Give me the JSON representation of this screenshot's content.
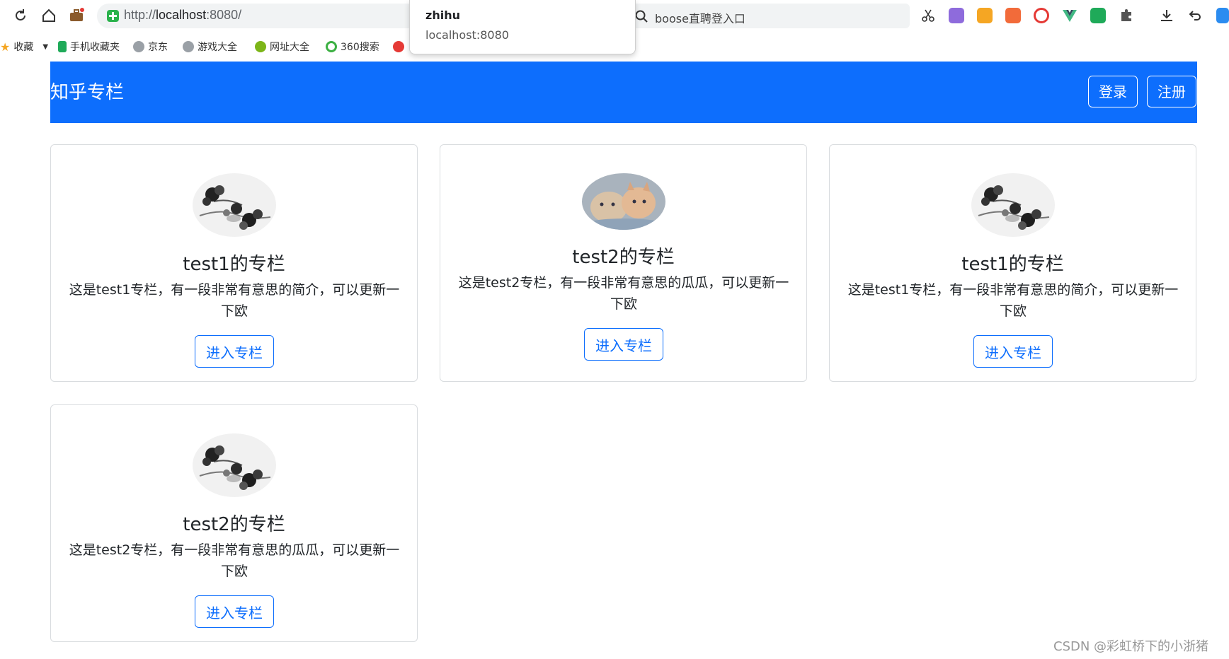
{
  "browser": {
    "url_prefix": "http://",
    "url_host": "localhost",
    "url_rest": ":8080/",
    "search_query": "boose直聘登入口",
    "tab_tooltip": {
      "title": "zhihu",
      "host": "localhost:8080"
    },
    "bookmarks": [
      {
        "label": "收藏"
      },
      {
        "label": "手机收藏夹"
      },
      {
        "label": "京东"
      },
      {
        "label": "游戏大全"
      },
      {
        "label": "网址大全"
      },
      {
        "label": "360搜索"
      }
    ]
  },
  "navbar": {
    "brand": "知乎专栏",
    "login_label": "登录",
    "register_label": "注册",
    "color": "#0d6efd"
  },
  "columns": [
    {
      "title": "test1的专栏",
      "description": "这是test1专栏，有一段非常有意思的简介，可以更新一下欧",
      "button_label": "进入专栏",
      "avatar": "ink-flower"
    },
    {
      "title": "test2的专栏",
      "description": "这是test2专栏，有一段非常有意思的瓜瓜，可以更新一下欧",
      "button_label": "进入专栏",
      "avatar": "kittens"
    },
    {
      "title": "test1的专栏",
      "description": "这是test1专栏，有一段非常有意思的简介，可以更新一下欧",
      "button_label": "进入专栏",
      "avatar": "ink-flower"
    },
    {
      "title": "test2的专栏",
      "description": "这是test2专栏，有一段非常有意思的瓜瓜，可以更新一下欧",
      "button_label": "进入专栏",
      "avatar": "ink-flower"
    }
  ],
  "watermark": "CSDN @彩虹桥下的小浙猪"
}
